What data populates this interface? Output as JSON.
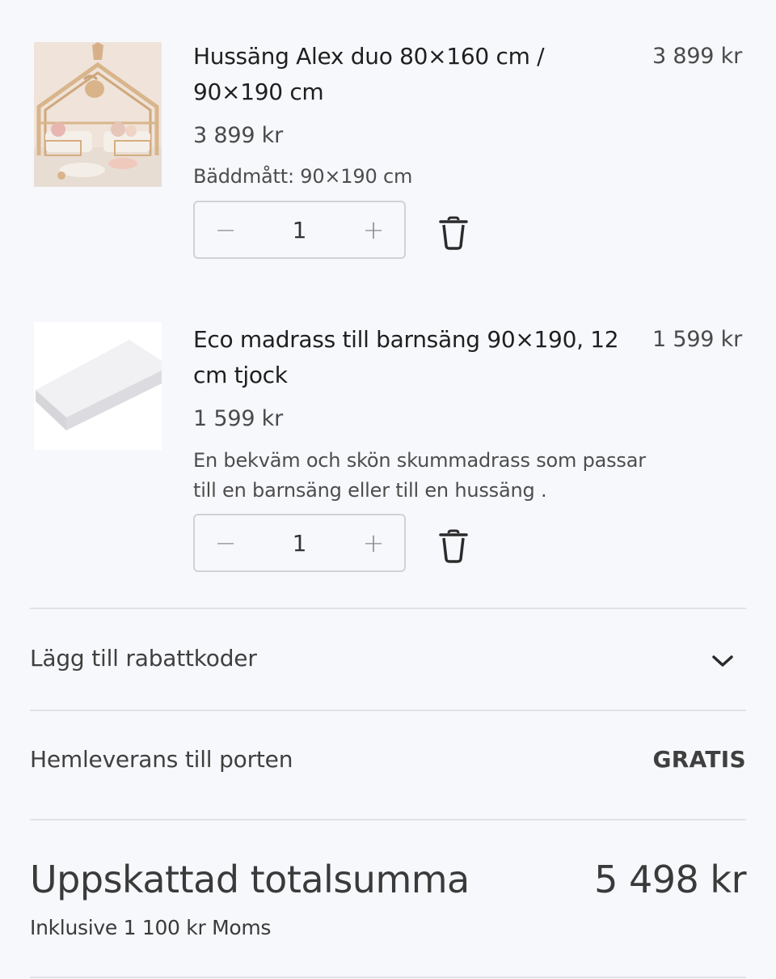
{
  "cart": {
    "items": [
      {
        "title": "Hussäng Alex duo 80×160 cm / 90×190 cm",
        "line_total": "3 899 kr",
        "unit_price": "3 899 kr",
        "detail": "Bäddmått: 90×190 cm",
        "quantity": "1",
        "image_icon": "house-bed-photo"
      },
      {
        "title": "Eco madrass till barnsäng 90×190, 12 cm tjock",
        "line_total": "1 599 kr",
        "unit_price": "1 599 kr",
        "detail": "En bekväm och skön skummadrass som passar till en barnsäng eller till en hussäng .",
        "quantity": "1",
        "image_icon": "mattress-photo"
      }
    ],
    "stepper": {
      "decrement": "−",
      "increment": "+"
    }
  },
  "discount": {
    "label": "Lägg till rabattkoder",
    "icon": "chevron-down-icon"
  },
  "shipping": {
    "label": "Hemleverans till porten",
    "value": "GRATIS"
  },
  "summary": {
    "total_label": "Uppskattad totalsumma",
    "total_value": "5 498 kr",
    "tax_note": "Inklusive 1 100 kr Moms"
  },
  "colors": {
    "background": "#f7f8fc",
    "text": "#2b2b2b",
    "border": "#cfd2d8",
    "divider": "#e0e2e7"
  }
}
